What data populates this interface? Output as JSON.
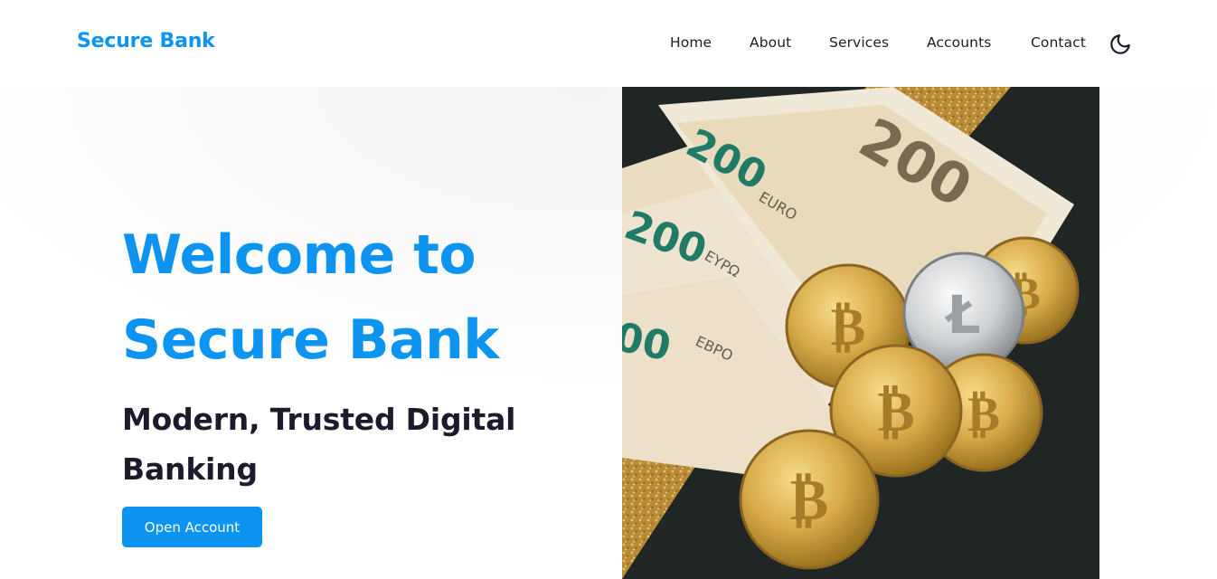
{
  "header": {
    "brand": "Secure Bank",
    "nav": [
      "Home",
      "About",
      "Services",
      "Accounts",
      "Contact"
    ],
    "theme_toggle_icon": "moon-icon"
  },
  "hero": {
    "title_line1": "Welcome to",
    "title_line2": "Secure Bank",
    "subtitle": "Modern, Trusted Digital Banking",
    "cta_label": "Open Account",
    "image_subject": "euro-banknotes-and-bitcoin-coins",
    "banknote_denominations": [
      "200",
      "200",
      "200",
      "00",
      "00"
    ],
    "banknote_texts": [
      "EURO",
      "EYPΩ",
      "EBPO"
    ]
  },
  "colors": {
    "brand": "#0d93f0",
    "heading_dark": "#1b1b2b",
    "nav_text": "#1d1d2c",
    "background": "#ffffff"
  }
}
